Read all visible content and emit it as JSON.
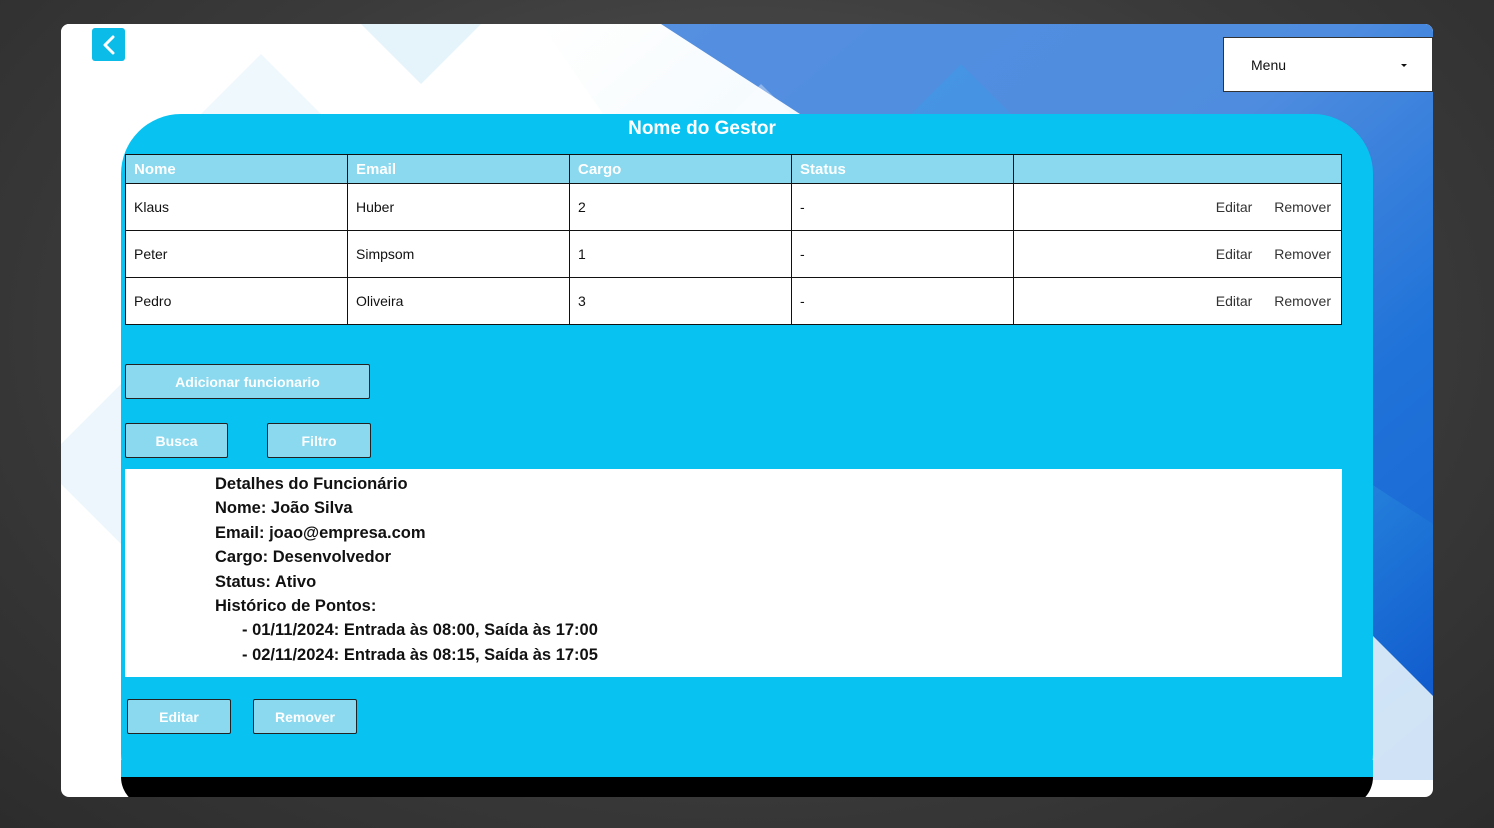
{
  "header": {
    "back_icon": "chevron-left-icon",
    "menu_label": "Menu",
    "menu_icon": "caret-down-icon"
  },
  "panel": {
    "title": "Nome do Gestor"
  },
  "table": {
    "columns": [
      "Nome",
      "Email",
      "Cargo",
      "Status",
      ""
    ],
    "rows": [
      {
        "nome": "Klaus",
        "email": "Huber",
        "cargo": "2",
        "status": "-",
        "edit": "Editar",
        "remove": "Remover"
      },
      {
        "nome": "Peter",
        "email": "Simpsom",
        "cargo": "1",
        "status": "-",
        "edit": "Editar",
        "remove": "Remover"
      },
      {
        "nome": "Pedro",
        "email": "Oliveira",
        "cargo": "3",
        "status": "-",
        "edit": "Editar",
        "remove": "Remover"
      }
    ]
  },
  "buttons": {
    "add": "Adicionar funcionario",
    "search": "Busca",
    "filter": "Filtro",
    "edit": "Editar",
    "remove": "Remover"
  },
  "details": {
    "heading": "Detalhes do Funcionário",
    "name": "Nome: João Silva",
    "email": "Email: joao@empresa.com",
    "role": "Cargo: Desenvolvedor",
    "status": "Status: Ativo",
    "history_label": "Histórico de Pontos:",
    "history": [
      "- 01/11/2024: Entrada às 08:00, Saída às 17:00",
      "- 02/11/2024: Entrada às 08:15, Saída às 17:05"
    ]
  },
  "colors": {
    "panel": "#08c3f2",
    "header_cell": "#8ad9ef",
    "accent_blue": "#1f6fd8"
  }
}
